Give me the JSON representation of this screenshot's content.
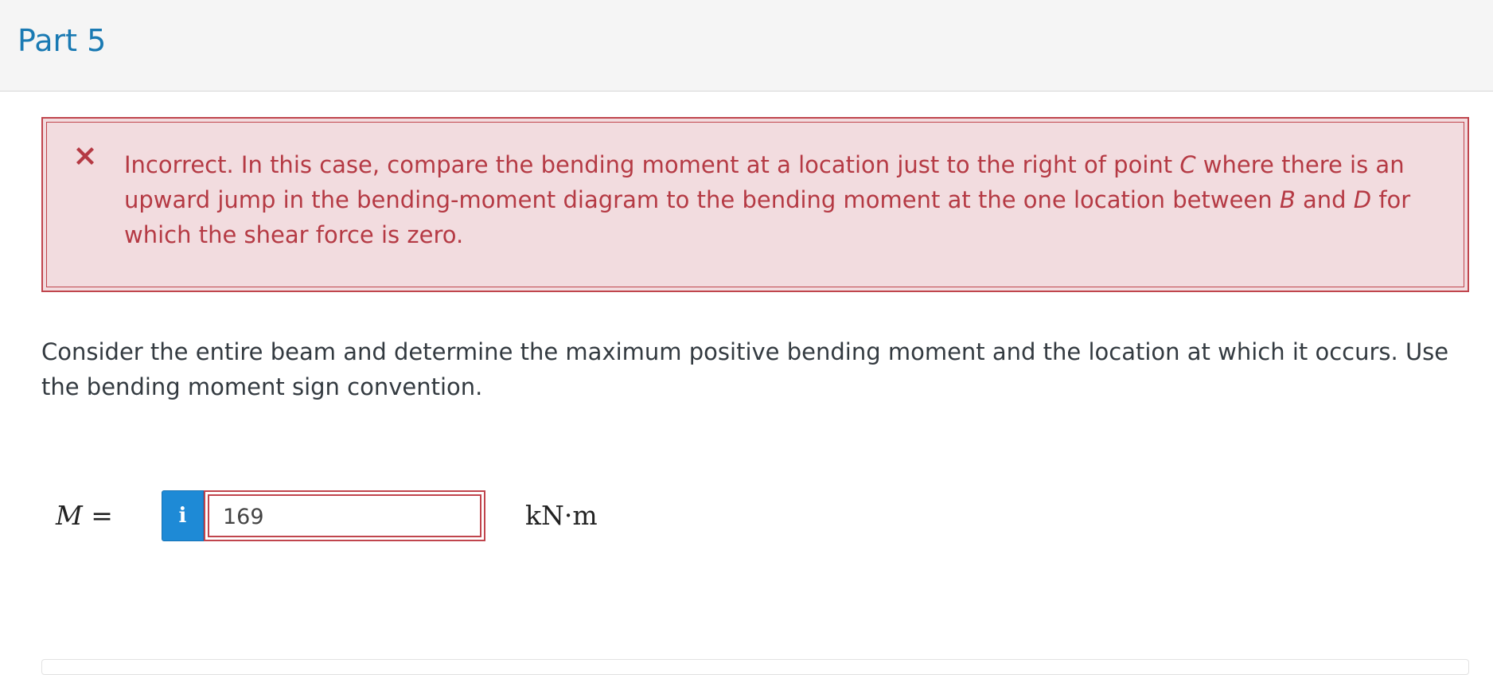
{
  "header": {
    "title": "Part 5"
  },
  "feedback": {
    "icon": "close-icon",
    "status_color": "#b53a44",
    "text_1": "Incorrect. In this case, compare the bending moment at a location just to the right of point ",
    "point_c": "C",
    "text_2": " where there is an upward jump in the bending-moment diagram to the bending moment at the one location between ",
    "point_b": "B",
    "text_3": " and ",
    "point_d": "D",
    "text_4": " for which the shear force is zero."
  },
  "question": {
    "text": "Consider the entire beam and determine the maximum positive bending moment and the location at which it occurs.  Use the bending moment sign convention."
  },
  "answer": {
    "variable": "M",
    "equals": "=",
    "info_button_label": "i",
    "value": "169",
    "unit": "kN·m"
  }
}
